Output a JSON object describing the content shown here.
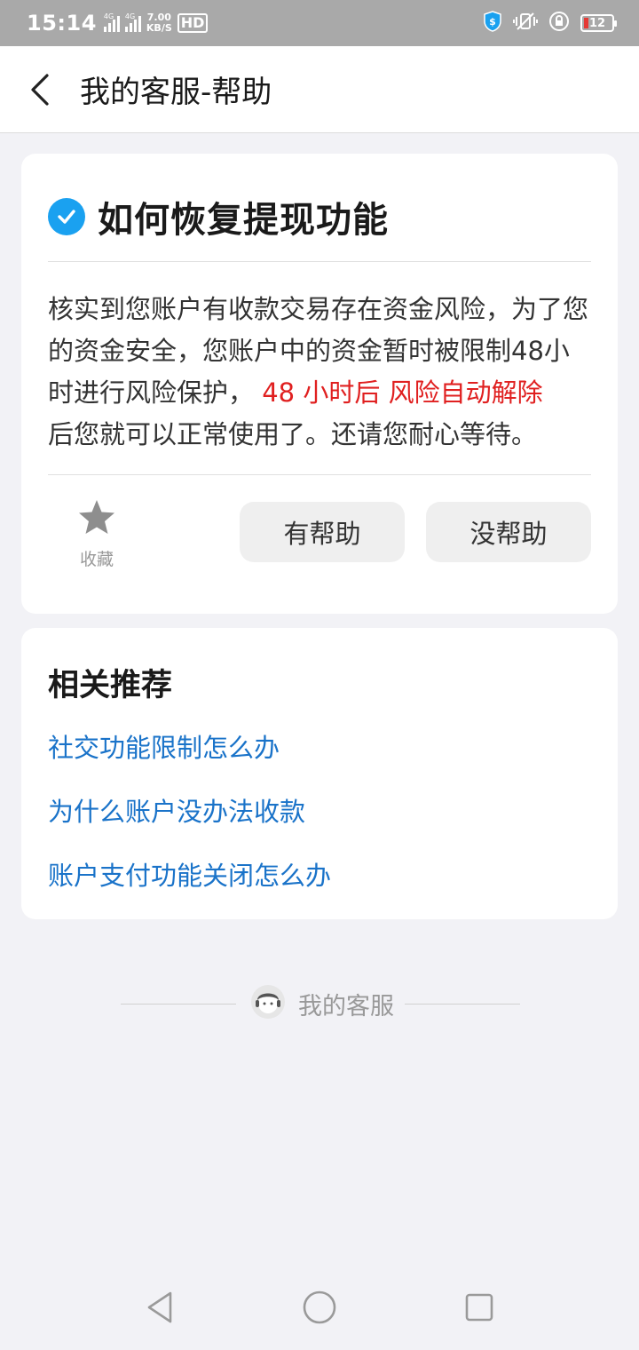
{
  "status_bar": {
    "time": "15:14",
    "network_1": "4G",
    "network_2": "4G",
    "speed_value": "7.00",
    "speed_unit": "KB/S",
    "hd_label": "HD",
    "battery": "12"
  },
  "header": {
    "title": "我的客服-帮助"
  },
  "question": {
    "title": "如何恢复提现功能",
    "answer_part1": "核实到您账户有收款交易存在资金风险，为了您的资金安全，您账户中的资金暂时被限制48小时进行风险保护，",
    "answer_highlight": " 48 小时后 风险自动解除",
    "answer_part2": "后您就可以正常使用了。还请您耐心等待。",
    "favorite_label": "收藏",
    "helpful_label": "有帮助",
    "not_helpful_label": "没帮助"
  },
  "related": {
    "title": "相关推荐",
    "items": [
      "社交功能限制怎么办",
      "为什么账户没办法收款",
      "账户支付功能关闭怎么办"
    ]
  },
  "footer": {
    "brand": "我的客服"
  },
  "colors": {
    "accent_blue": "#1aa1f0",
    "link_blue": "#1a73c9",
    "highlight_red": "#e02020"
  }
}
